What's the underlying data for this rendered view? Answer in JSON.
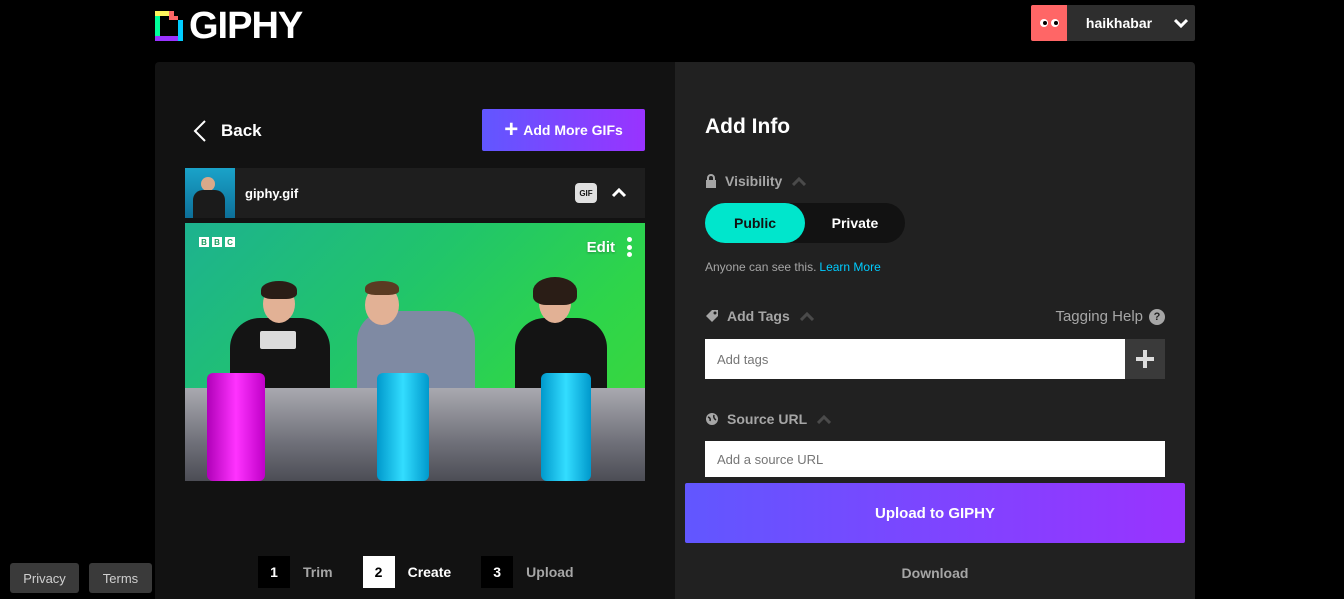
{
  "header": {
    "logo_text": "GIPHY",
    "username": "haikhabar"
  },
  "left": {
    "back_label": "Back",
    "add_more_label": "Add More GIFs",
    "file": {
      "name": "giphy.gif",
      "badge": "GIF"
    },
    "preview": {
      "watermark": [
        "B",
        "B",
        "C"
      ],
      "edit_label": "Edit"
    },
    "steps": [
      {
        "number": "1",
        "label": "Trim",
        "state": "inactive"
      },
      {
        "number": "2",
        "label": "Create",
        "state": "active"
      },
      {
        "number": "3",
        "label": "Upload",
        "state": "inactive"
      }
    ]
  },
  "right": {
    "title": "Add Info",
    "visibility": {
      "label": "Visibility",
      "options": [
        "Public",
        "Private"
      ],
      "selected": "Public",
      "note": "Anyone can see this.",
      "learn_more": "Learn More"
    },
    "tags": {
      "label": "Add Tags",
      "help": "Tagging Help",
      "help_icon": "?",
      "placeholder": "Add tags"
    },
    "source": {
      "label": "Source URL",
      "placeholder": "Add a source URL"
    },
    "upload_label": "Upload to GIPHY",
    "download_label": "Download"
  },
  "footer": {
    "privacy": "Privacy",
    "terms": "Terms"
  },
  "colors": {
    "accent_purple": "#6157ff",
    "accent_violet": "#9933ff",
    "toggle_on": "#00e6cc",
    "link": "#00ccff",
    "avatar_bg": "#ff6666"
  }
}
